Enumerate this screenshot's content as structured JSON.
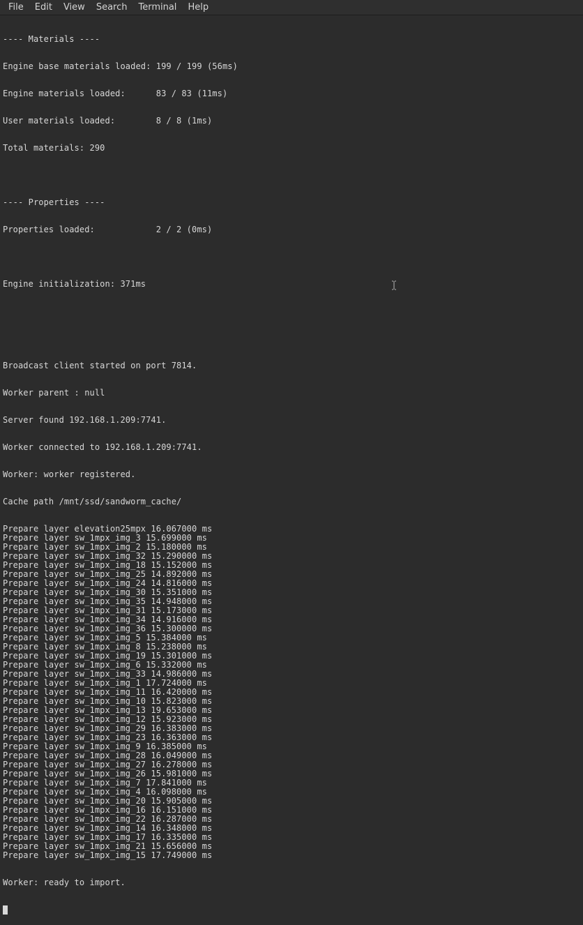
{
  "menu": {
    "file": "File",
    "edit": "Edit",
    "view": "View",
    "search": "Search",
    "terminal": "Terminal",
    "help": "Help"
  },
  "output": {
    "materials_header": "---- Materials ----",
    "engine_base": "Engine base materials loaded: 199 / 199 (56ms)",
    "engine_mat": "Engine materials loaded:      83 / 83 (11ms)",
    "user_mat": "User materials loaded:        8 / 8 (1ms)",
    "total_mat": "Total materials: 290",
    "properties_header": "---- Properties ----",
    "properties_loaded": "Properties loaded:            2 / 2 (0ms)",
    "engine_init": "Engine initialization: 371ms",
    "broadcast": "Broadcast client started on port 7814.",
    "worker_parent": "Worker parent : null",
    "server_found": "Server found 192.168.1.209:7741.",
    "worker_connected": "Worker connected to 192.168.1.209:7741.",
    "worker_registered": "Worker: worker registered.",
    "cache_path": "Cache path /mnt/ssd/sandworm_cache/",
    "worker_ready": "Worker: ready to import.",
    "layers": [
      "Prepare layer elevation25mpx 16.067000 ms",
      "Prepare layer sw_1mpx_img_3 15.699000 ms",
      "Prepare layer sw_1mpx_img_2 15.180000 ms",
      "Prepare layer sw_1mpx_img_32 15.290000 ms",
      "Prepare layer sw_1mpx_img_18 15.152000 ms",
      "Prepare layer sw_1mpx_img_25 14.892000 ms",
      "Prepare layer sw_1mpx_img_24 14.816000 ms",
      "Prepare layer sw_1mpx_img_30 15.351000 ms",
      "Prepare layer sw_1mpx_img_35 14.948000 ms",
      "Prepare layer sw_1mpx_img_31 15.173000 ms",
      "Prepare layer sw_1mpx_img_34 14.916000 ms",
      "Prepare layer sw_1mpx_img_36 15.300000 ms",
      "Prepare layer sw_1mpx_img_5 15.384000 ms",
      "Prepare layer sw_1mpx_img_8 15.238000 ms",
      "Prepare layer sw_1mpx_img_19 15.301000 ms",
      "Prepare layer sw_1mpx_img_6 15.332000 ms",
      "Prepare layer sw_1mpx_img_33 14.986000 ms",
      "Prepare layer sw_1mpx_img_1 17.724000 ms",
      "Prepare layer sw_1mpx_img_11 16.420000 ms",
      "Prepare layer sw_1mpx_img_10 15.823000 ms",
      "Prepare layer sw_1mpx_img_13 19.653000 ms",
      "Prepare layer sw_1mpx_img_12 15.923000 ms",
      "Prepare layer sw_1mpx_img_29 16.383000 ms",
      "Prepare layer sw_1mpx_img_23 16.363000 ms",
      "Prepare layer sw_1mpx_img_9 16.385000 ms",
      "Prepare layer sw_1mpx_img_28 16.049000 ms",
      "Prepare layer sw_1mpx_img_27 16.278000 ms",
      "Prepare layer sw_1mpx_img_26 15.981000 ms",
      "Prepare layer sw_1mpx_img_7 17.841000 ms",
      "Prepare layer sw_1mpx_img_4 16.098000 ms",
      "Prepare layer sw_1mpx_img_20 15.905000 ms",
      "Prepare layer sw_1mpx_img_16 16.151000 ms",
      "Prepare layer sw_1mpx_img_22 16.287000 ms",
      "Prepare layer sw_1mpx_img_14 16.348000 ms",
      "Prepare layer sw_1mpx_img_17 16.335000 ms",
      "Prepare layer sw_1mpx_img_21 15.656000 ms",
      "Prepare layer sw_1mpx_img_15 17.749000 ms"
    ]
  }
}
